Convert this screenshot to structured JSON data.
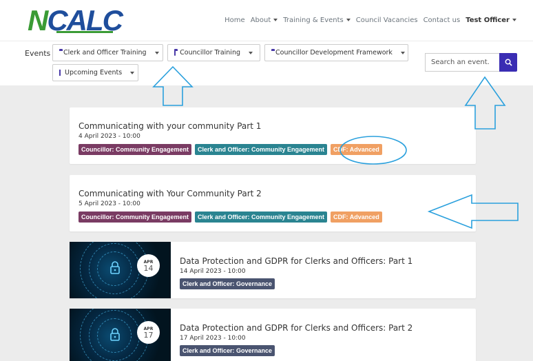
{
  "header": {
    "logo_n": "N",
    "logo_rest": "CALC",
    "nav": [
      {
        "label": "Home",
        "dropdown": false,
        "bold": false
      },
      {
        "label": "About",
        "dropdown": true,
        "bold": false
      },
      {
        "label": "Training & Events",
        "dropdown": true,
        "bold": false
      },
      {
        "label": "Council Vacancies",
        "dropdown": false,
        "bold": false
      },
      {
        "label": "Contact us",
        "dropdown": false,
        "bold": false
      },
      {
        "label": "Test Officer",
        "dropdown": true,
        "bold": true
      }
    ]
  },
  "filters": {
    "events_label": "Events",
    "dropdowns": [
      {
        "label": "Clerk and Officer Training",
        "icon": "folder-icon"
      },
      {
        "label": "Councillor Training",
        "icon": "folder-icon"
      },
      {
        "label": "Councillor Development Framework",
        "icon": "folder-icon"
      },
      {
        "label": "Upcoming Events",
        "icon": "calendar-icon"
      }
    ],
    "search_placeholder": "Search an event.",
    "search_icon": "search-icon"
  },
  "events": [
    {
      "title": "Communicating with your community Part 1",
      "date": "4 April 2023 - 10:00",
      "tags": [
        "Councillor: Community Engagement",
        "Clerk and Officer: Community Engagement",
        "CDF: Advanced"
      ]
    },
    {
      "title": "Communicating with Your Community Part 2",
      "date": "5 April 2023 - 10:00",
      "tags": [
        "Councillor: Community Engagement",
        "Clerk and Officer: Community Engagement",
        "CDF: Advanced"
      ]
    },
    {
      "title": "Data Protection and GDPR for Clerks and Officers: Part 1",
      "date": "14 April 2023 - 10:00",
      "badge_month": "APR",
      "badge_day": "14",
      "tags": [
        "Clerk and Officer: Governance"
      ]
    },
    {
      "title": "Data Protection and GDPR for Clerks and Officers: Part 2",
      "date": "17 April 2023 - 10:00",
      "badge_month": "APR",
      "badge_day": "17",
      "tags": [
        "Clerk and Officer: Governance"
      ]
    }
  ],
  "colors": {
    "accent": "#3a2db3",
    "logo_green": "#3a9b35",
    "logo_blue": "#1f4e9c",
    "tag_councillor": "#7a3b63",
    "tag_clerk": "#2a8491",
    "tag_cdf": "#f0a063",
    "tag_governance": "#4a5470",
    "annotation": "#2aa0dd"
  }
}
